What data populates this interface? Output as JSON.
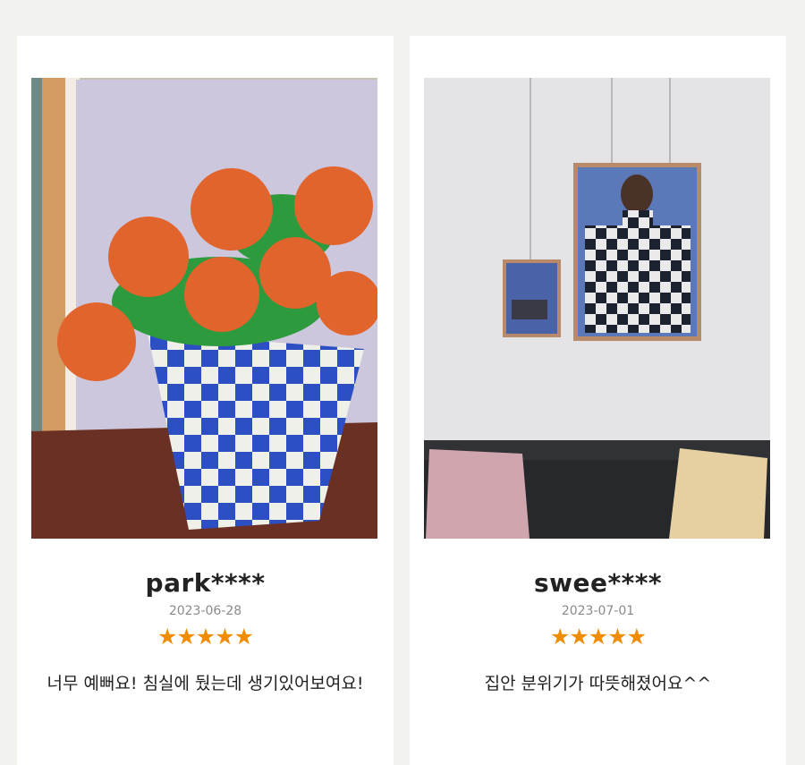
{
  "reviews": [
    {
      "username": "park****",
      "date": "2023-06-28",
      "rating": 5,
      "stars": "★★★★★",
      "text": "너무 예뻐요! 침실에 뒀는데 생기있어보여요!",
      "photo_icon": "flower-vase-painting"
    },
    {
      "username": "swee****",
      "date": "2023-07-01",
      "rating": 5,
      "stars": "★★★★★",
      "text": "집안 분위기가 따뜻해졌어요^^",
      "photo_icon": "framed-art-on-wall"
    }
  ],
  "colors": {
    "page_bg": "#f2f2ef",
    "card_bg": "#ffffff",
    "star": "#f08c00",
    "username": "#222222",
    "date": "#8a8a8a"
  }
}
